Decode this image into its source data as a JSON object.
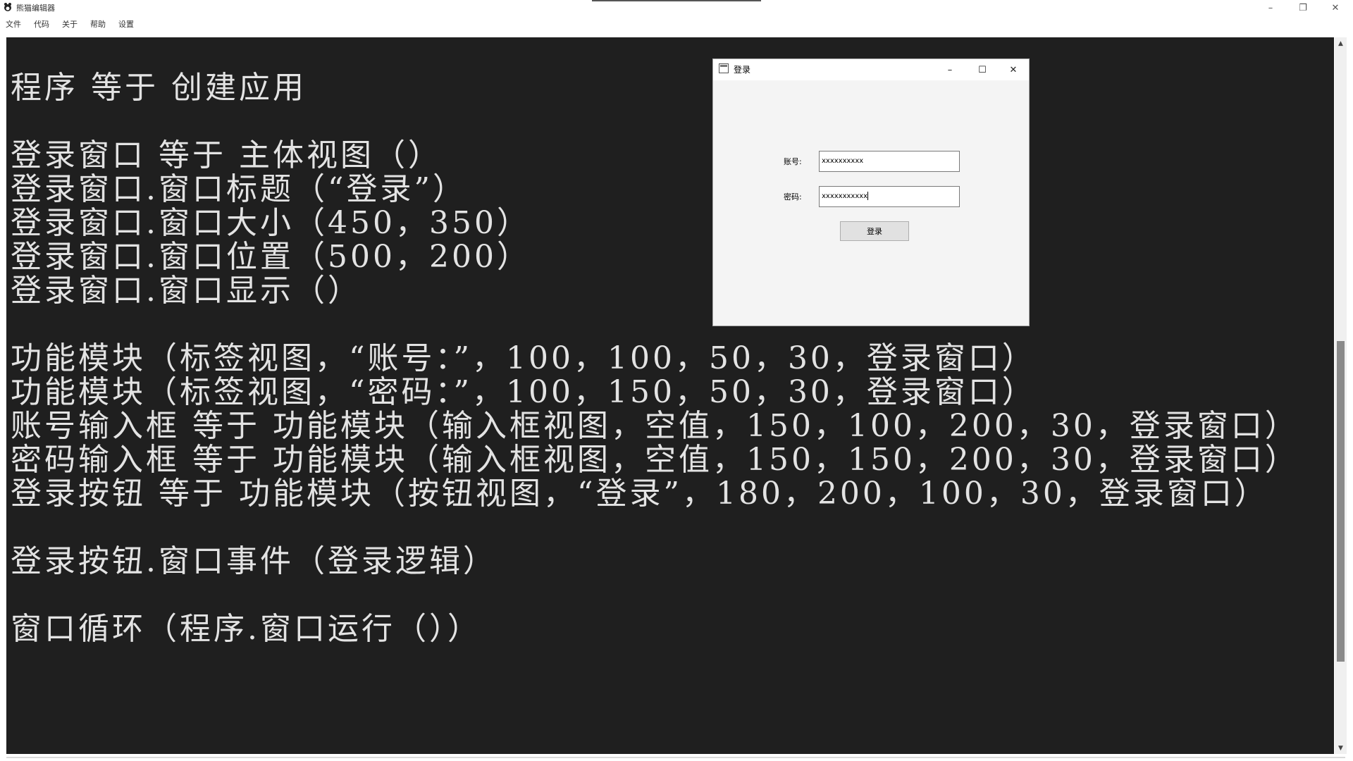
{
  "window": {
    "title": "熊猫编辑器",
    "controls": {
      "minimize": "–",
      "restore": "❐",
      "close": "✕"
    }
  },
  "menu": {
    "items": [
      "文件",
      "代码",
      "关于",
      "帮助",
      "设置"
    ]
  },
  "editor": {
    "lines": [
      "程序 等于 创建应用",
      "",
      "登录窗口 等于 主体视图（）",
      "登录窗口.窗口标题（“登录”）",
      "登录窗口.窗口大小（450，350）",
      "登录窗口.窗口位置（500，200）",
      "登录窗口.窗口显示（）",
      "",
      "功能模块（标签视图，“账号：”，100，100，50，30，登录窗口）",
      "功能模块（标签视图，“密码：”，100，150，50，30，登录窗口）",
      "账号输入框 等于 功能模块（输入框视图，空值，150，100，200，30，登录窗口）",
      "密码输入框 等于 功能模块（输入框视图，空值，150，150，200，30，登录窗口）",
      "登录按钮 等于 功能模块（按钮视图，“登录”，180，200，100，30，登录窗口）",
      "",
      "登录按钮.窗口事件（登录逻辑）",
      "",
      "窗口循环（程序.窗口运行（））"
    ]
  },
  "scrollbar": {
    "up": "▲",
    "down": "▼"
  },
  "login_dialog": {
    "title": "登录",
    "controls": {
      "minimize": "–",
      "maximize": "☐",
      "close": "✕"
    },
    "account_label": "账号:",
    "account_value": "xxxxxxxxxx",
    "password_label": "密码:",
    "password_value": "xxxxxxxxxxx",
    "login_button": "登录"
  },
  "colors": {
    "editor_bg": "#1f1f1f",
    "editor_text": "#e3e3e3",
    "dialog_bg": "#f4f4f4"
  }
}
